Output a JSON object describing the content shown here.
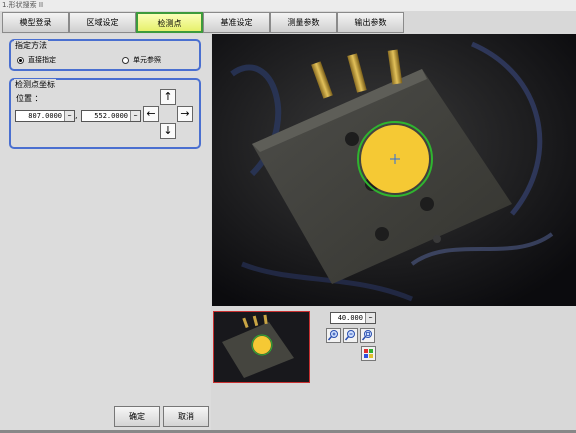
{
  "window": {
    "title": "1.形状搜索 II"
  },
  "tabs": [
    {
      "label": "模型登录",
      "active": false
    },
    {
      "label": "区域设定",
      "active": false
    },
    {
      "label": "检测点",
      "active": true
    },
    {
      "label": "基准设定",
      "active": false
    },
    {
      "label": "测量参数",
      "active": false
    },
    {
      "label": "输出参数",
      "active": false
    }
  ],
  "method_group": {
    "title": "指定方法",
    "option_direct": "直接指定",
    "option_unit": "单元参照",
    "selected": "直接指定"
  },
  "coord_group": {
    "title": "检测点坐标",
    "position_label": "位置 ：",
    "x_value": "807.0000",
    "separator": ",",
    "y_value": "552.0000",
    "more_glyph": "…"
  },
  "arrows": {
    "up": "↑",
    "down": "↓",
    "left": "←",
    "right": "→"
  },
  "zoom": {
    "value": "40.000",
    "more_glyph": "…"
  },
  "icons": {
    "zoom_in": "zoom-in-icon",
    "zoom_out": "zoom-out-icon",
    "zoom_fit": "zoom-fit-icon",
    "color": "color-palette-icon"
  },
  "colors": {
    "detection_circle": "#f5c934",
    "detection_ring": "#2fb52f",
    "active_tab": "#e6f06c",
    "group_border": "#4a6fd0"
  },
  "buttons": {
    "ok": "确定",
    "cancel": "取消"
  }
}
